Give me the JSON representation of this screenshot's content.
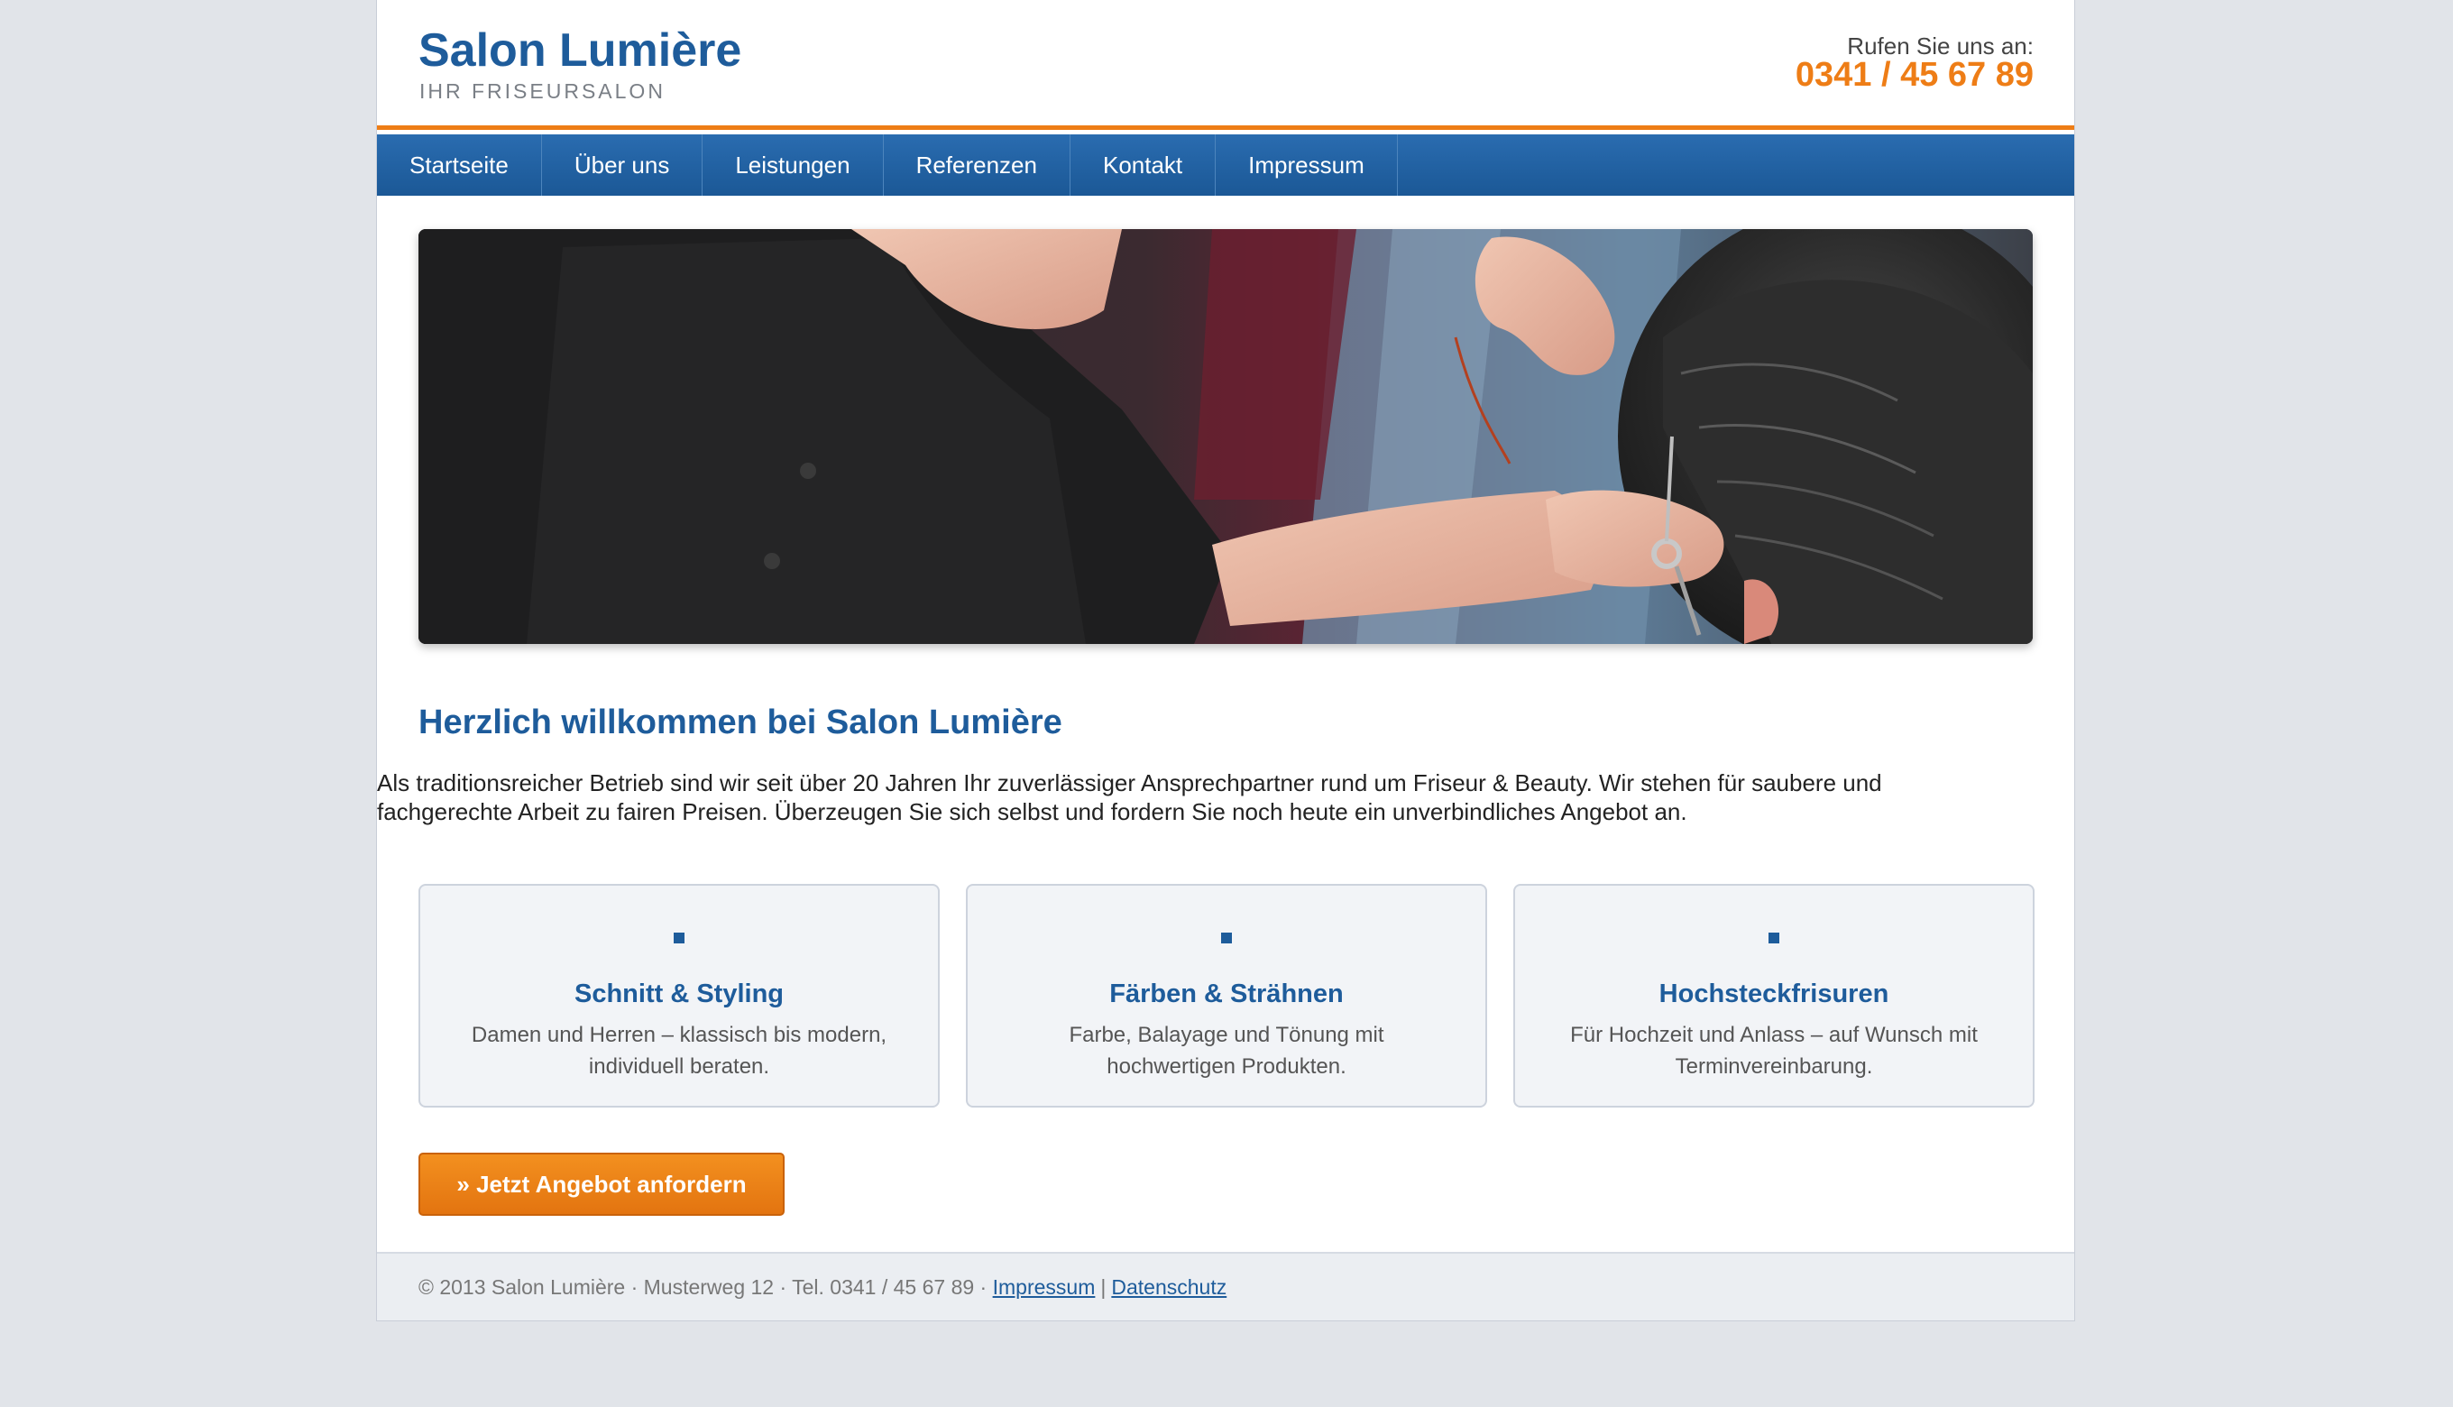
{
  "header": {
    "brand_title": "Salon Lumière",
    "brand_subtitle": "IHR FRISEURSALON",
    "call_label": "Rufen Sie uns an:",
    "phone": "0341 / 45 67 89"
  },
  "nav": {
    "items": [
      {
        "label": "Startseite"
      },
      {
        "label": "Über uns"
      },
      {
        "label": "Leistungen"
      },
      {
        "label": "Referenzen"
      },
      {
        "label": "Kontakt"
      },
      {
        "label": "Impressum"
      }
    ]
  },
  "hero": {
    "image": "hairdresser-cutting-hair-photo"
  },
  "welcome": {
    "title": "Herzlich willkommen bei Salon Lumière",
    "text": "Als traditionsreicher Betrieb sind wir seit über 20 Jahren Ihr zuverlässiger Ansprechpartner rund um Friseur & Beauty. Wir stehen für saubere und fachgerechte Arbeit zu fairen Preisen. Überzeugen Sie sich selbst und fordern Sie noch heute ein unverbindliches Angebot an."
  },
  "features": [
    {
      "title": "Schnitt & Styling",
      "text": "Damen und Herren – klassisch bis modern, individuell beraten.",
      "icon": "square-bullet-icon"
    },
    {
      "title": "Färben & Strähnen",
      "text": "Farbe, Balayage und Tönung mit hochwertigen Produkten.",
      "icon": "square-bullet-icon"
    },
    {
      "title": "Hochsteckfrisuren",
      "text": "Für Hochzeit und Anlass – auf Wunsch mit Terminvereinbarung.",
      "icon": "square-bullet-icon"
    }
  ],
  "cta": {
    "label": "» Jetzt Angebot anfordern"
  },
  "footer": {
    "copyright": "© 2013 Salon Lumière · Musterweg 12 · Tel. 0341 / 45 67 89 ·",
    "impressum_link": "Impressum",
    "separator": "|",
    "datenschutz_link": "Datenschutz"
  },
  "colors": {
    "brand_blue": "#1e5c9b",
    "accent_orange": "#ee7d16",
    "background": "#e1e4e9"
  }
}
